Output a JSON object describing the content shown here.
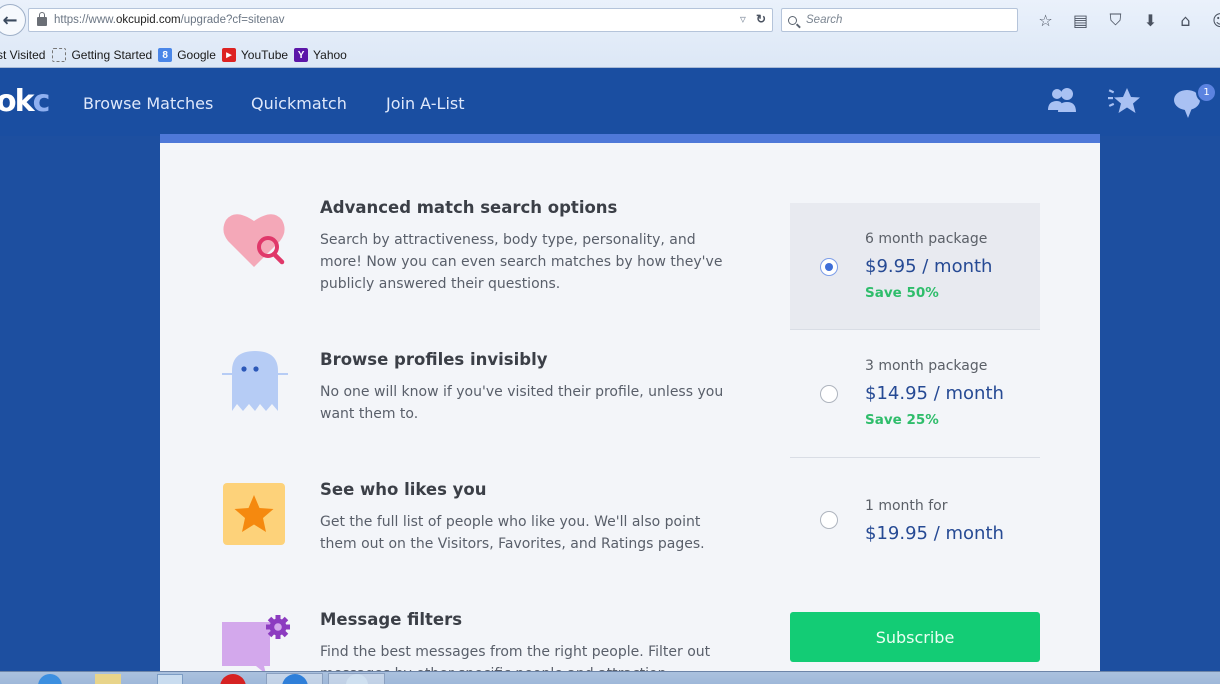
{
  "browser": {
    "back_icon": "back-arrow-icon",
    "url_prefix": "https://www.",
    "url_host": "okcupid.com",
    "url_path": "/upgrade?cf=sitenav",
    "url_dropdown_glyph": "▿",
    "reload_glyph": "↻",
    "search_placeholder": "Search",
    "toolbar_icons": [
      {
        "name": "bookmark-star-icon",
        "glyph": "☆"
      },
      {
        "name": "reading-list-icon",
        "glyph": "▤"
      },
      {
        "name": "pocket-icon",
        "glyph": "⛉"
      },
      {
        "name": "download-icon",
        "glyph": "⬇"
      },
      {
        "name": "home-icon",
        "glyph": "⌂"
      },
      {
        "name": "chat-icon",
        "glyph": "☺"
      }
    ],
    "bookmarks": [
      {
        "label": "st Visited",
        "icon": ""
      },
      {
        "label": "Getting Started",
        "icon": "getting-started-icon",
        "glyph": ""
      },
      {
        "label": "Google",
        "icon": "google-icon",
        "glyph": "8"
      },
      {
        "label": "YouTube",
        "icon": "youtube-icon",
        "glyph": "▶"
      },
      {
        "label": "Yahoo",
        "icon": "yahoo-icon",
        "glyph": "Y"
      }
    ]
  },
  "site": {
    "logo_main": "ok",
    "logo_accent": "c",
    "nav": [
      {
        "label": "Browse Matches"
      },
      {
        "label": "Quickmatch"
      },
      {
        "label": "Join A-List"
      }
    ],
    "messages_badge": "1"
  },
  "features": [
    {
      "title": "Advanced match search options",
      "description": "Search by attractiveness, body type, personality, and more! Now you can even search matches by how they've publicly answered their questions.",
      "icon": "heart-search-icon"
    },
    {
      "title": "Browse profiles invisibly",
      "description": "No one will know if you've visited their profile, unless you want them to.",
      "icon": "ghost-icon"
    },
    {
      "title": "See who likes you",
      "description": "Get the full list of people who like you. We'll also point them out on the Visitors, Favorites, and Ratings pages.",
      "icon": "star-icon"
    },
    {
      "title": "Message filters",
      "description": "Find the best messages from the right people. Filter out messages by other specific people and attraction...",
      "icon": "message-gear-icon"
    }
  ],
  "plans": [
    {
      "label": "6 month package",
      "price": "$9.95 / month",
      "save": "Save 50%",
      "selected": true
    },
    {
      "label": "3 month package",
      "price": "$14.95 / month",
      "save": "Save 25%",
      "selected": false
    },
    {
      "label": "1 month for",
      "price": "$19.95 / month",
      "save": "",
      "selected": false
    }
  ],
  "subscribe_label": "Subscribe",
  "colors": {
    "nav_bg": "#1a4ea1",
    "accent_bar": "#4e78d8",
    "price_blue": "#264a94",
    "save_green": "#2fbd6b",
    "subscribe_green": "#13cc75"
  }
}
